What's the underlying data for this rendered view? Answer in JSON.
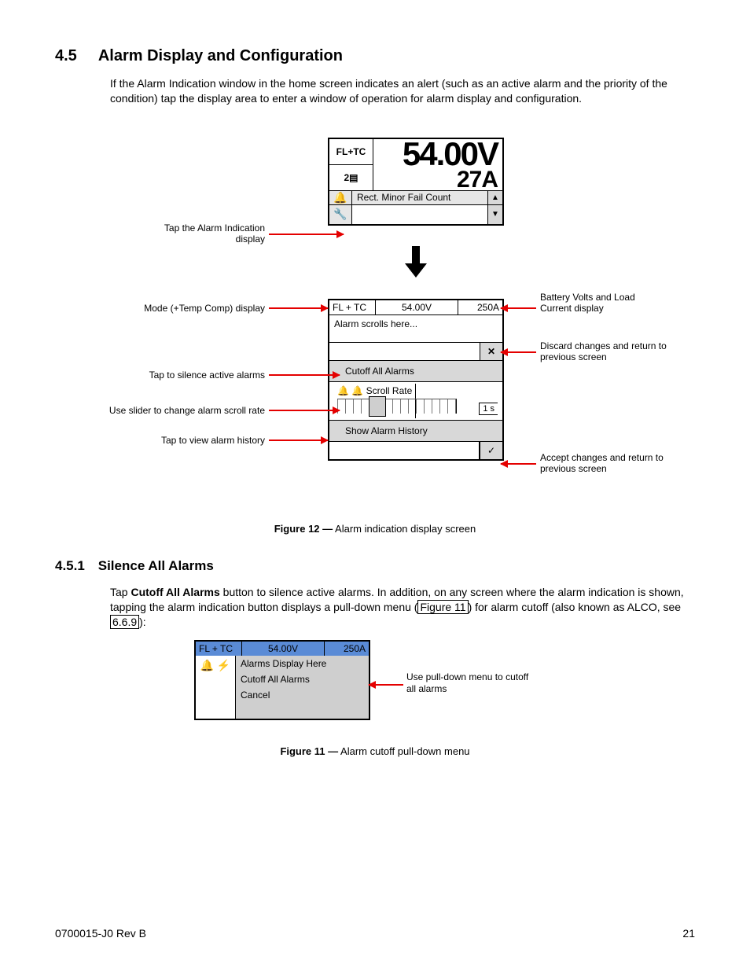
{
  "section": {
    "num": "4.5",
    "title": "Alarm Display and Configuration",
    "para": "If the Alarm Indication window in the home screen indicates an alert (such as an active alarm and the priority of the condition) tap the display area to enter a window of operation for alarm display and configuration."
  },
  "fig12": {
    "home": {
      "mode": "FL+TC",
      "count": "2",
      "volts": "54.00V",
      "amps": "27A",
      "msg": "Rect. Minor Fail Count"
    },
    "cfg": {
      "mode": "FL + TC",
      "volts": "54.00V",
      "amps": "250A",
      "scroll": "Alarm scrolls here...",
      "cutoff": "Cutoff All Alarms",
      "ratelbl": "Scroll Rate",
      "rateval": "1 s",
      "history": "Show Alarm History"
    },
    "callouts": {
      "tapAlarm": "Tap the Alarm Indication display",
      "modeDisp": "Mode (+Temp Comp) display",
      "silence": "Tap to silence active alarms",
      "slider": "Use slider to change alarm scroll rate",
      "history": "Tap to view alarm history",
      "battery": "Battery Volts and Load Current display",
      "discard": "Discard changes and return to previous screen",
      "accept": "Accept changes and return to previous screen"
    },
    "caption_b": "Figure 12  —",
    "caption": "  Alarm indication display screen"
  },
  "sub451": {
    "num": "4.5.1",
    "title": "Silence All Alarms",
    "p_a": "Tap ",
    "p_b": "Cutoff All Alarms",
    "p_c": " button to silence active alarms. In addition, on any screen where the alarm indication is shown, tapping the alarm indication button displays a pull-down menu (",
    "ref1": "Figure 11",
    "p_d": ") for alarm cutoff (also known as ALCO, see ",
    "ref2": "6.6.9",
    "p_e": "):"
  },
  "fig11": {
    "hdr": {
      "mode": "FL + TC",
      "volts": "54.00V",
      "amps": "250A"
    },
    "menu1": "Alarms Display Here",
    "menu2": "Cutoff All Alarms",
    "menu3": "Cancel",
    "callout": "Use pull-down menu to cutoff all alarms",
    "caption_b": "Figure 11  —",
    "caption": "  Alarm cutoff pull-down menu"
  },
  "footer": {
    "doc": "0700015-J0    Rev B",
    "page": "21"
  }
}
